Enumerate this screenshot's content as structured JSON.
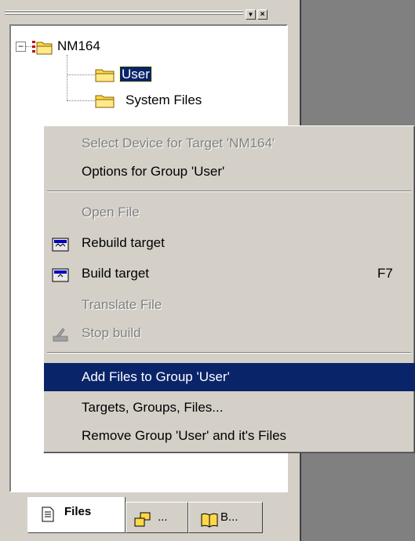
{
  "tree": {
    "root_label": "NM164",
    "children": [
      "User",
      "System Files"
    ],
    "selected": "User"
  },
  "context_menu": {
    "items": [
      {
        "label": "Select Device for Target 'NM164'",
        "enabled": false
      },
      {
        "label": "Options for Group 'User'",
        "enabled": true
      },
      {
        "label": "Open File",
        "enabled": false
      },
      {
        "label": "Rebuild target",
        "enabled": true,
        "icon": "rebuild-icon"
      },
      {
        "label": "Build target",
        "enabled": true,
        "icon": "build-icon",
        "shortcut": "F7"
      },
      {
        "label": "Translate File",
        "enabled": false
      },
      {
        "label": "Stop build",
        "enabled": false,
        "icon": "stop-build-icon"
      },
      {
        "label": "Add Files to Group 'User'",
        "enabled": true,
        "highlighted": true
      },
      {
        "label": "Targets, Groups, Files...",
        "enabled": true
      },
      {
        "label": "Remove Group 'User' and it's Files",
        "enabled": true
      }
    ]
  },
  "tabs": [
    {
      "label": "Files",
      "active": true,
      "icon": "files-icon"
    },
    {
      "label": "...",
      "active": false,
      "icon": "regs-icon"
    },
    {
      "label": "B...",
      "active": false,
      "icon": "books-icon"
    }
  ],
  "colors": {
    "face": "#d4d0c8",
    "highlight": "#0a246a",
    "dark_area": "#808080"
  }
}
